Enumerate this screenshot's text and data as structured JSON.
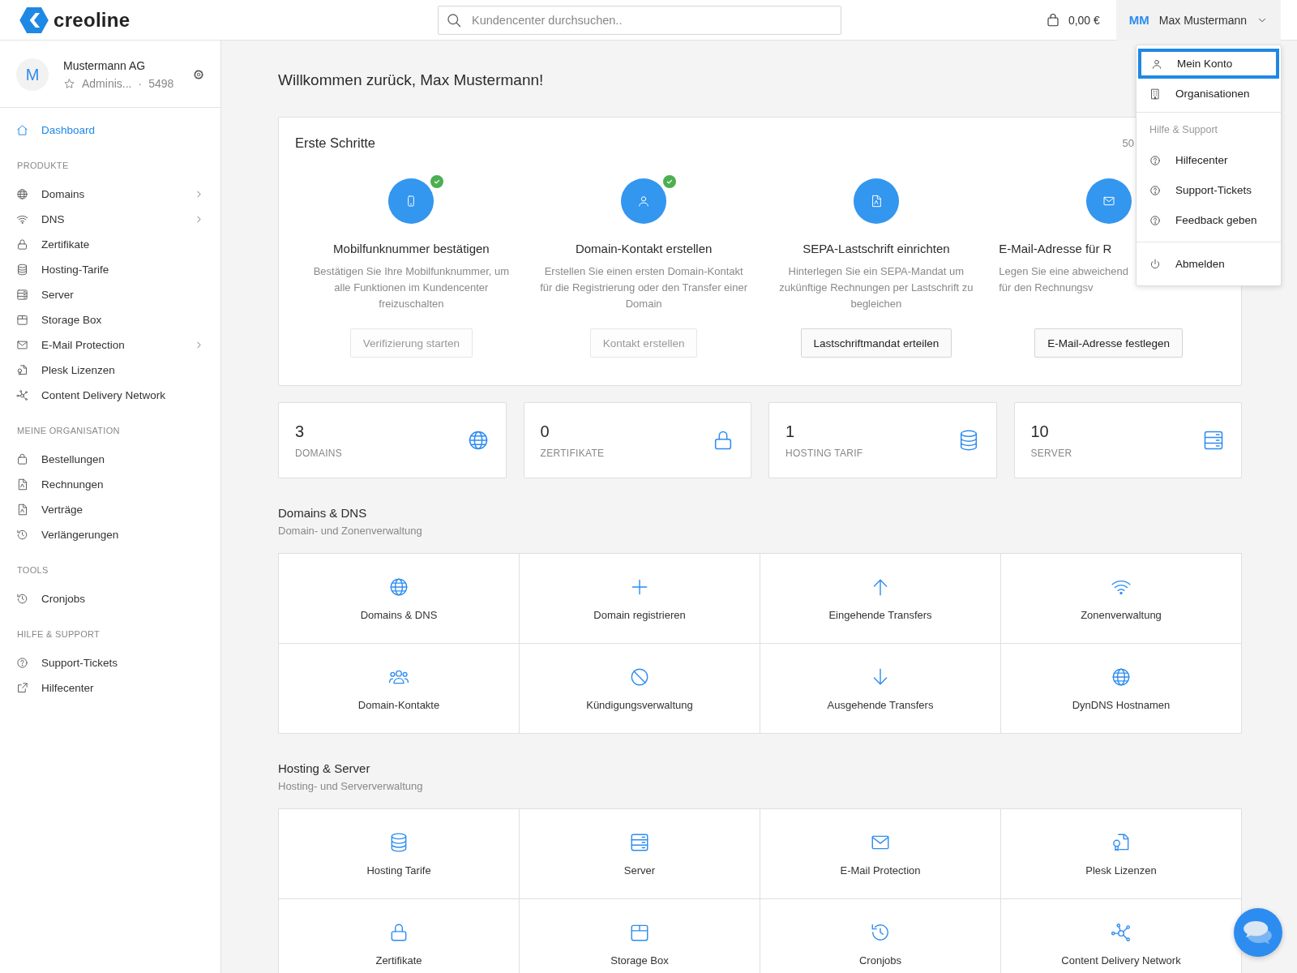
{
  "header": {
    "brand": "creoline",
    "search": {
      "placeholder": "Kundencenter durchsuchen.."
    },
    "cart_total": "0,00 €",
    "user": {
      "initials": "MM",
      "name": "Max Mustermann",
      "menu_open": true
    }
  },
  "user_menu": {
    "groups": [
      {
        "items": [
          {
            "label": "Mein Konto",
            "selected": true
          },
          {
            "label": "Organisationen",
            "selected": false
          }
        ]
      },
      {
        "heading": "Hilfe & Support",
        "items": [
          {
            "label": "Hilfecenter",
            "selected": false
          },
          {
            "label": "Support-Tickets",
            "selected": false
          },
          {
            "label": "Feedback geben",
            "selected": false
          }
        ]
      },
      {
        "items": [
          {
            "label": "Abmelden",
            "selected": false
          }
        ]
      }
    ]
  },
  "sidebar": {
    "organization": {
      "avatar": "M",
      "name": "Mustermann AG",
      "role": "Adminis...",
      "separator": "·",
      "number": "5498"
    },
    "sections": [
      {
        "items": [
          {
            "label": "Dashboard",
            "selected": true,
            "expandable": false
          }
        ]
      },
      {
        "heading": "PRODUKTE",
        "items": [
          {
            "label": "Domains",
            "selected": false,
            "expandable": true
          },
          {
            "label": "DNS",
            "selected": false,
            "expandable": true
          },
          {
            "label": "Zertifikate",
            "selected": false,
            "expandable": false
          },
          {
            "label": "Hosting-Tarife",
            "selected": false,
            "expandable": false
          },
          {
            "label": "Server",
            "selected": false,
            "expandable": false
          },
          {
            "label": "Storage Box",
            "selected": false,
            "expandable": false
          },
          {
            "label": "E-Mail Protection",
            "selected": false,
            "expandable": true
          },
          {
            "label": "Plesk Lizenzen",
            "selected": false,
            "expandable": false
          },
          {
            "label": "Content Delivery Network",
            "selected": false,
            "expandable": false
          }
        ]
      },
      {
        "heading": "MEINE ORGANISATION",
        "items": [
          {
            "label": "Bestellungen",
            "selected": false,
            "expandable": false
          },
          {
            "label": "Rechnungen",
            "selected": false,
            "expandable": false
          },
          {
            "label": "Verträge",
            "selected": false,
            "expandable": false
          },
          {
            "label": "Verlängerungen",
            "selected": false,
            "expandable": false
          }
        ]
      },
      {
        "heading": "TOOLS",
        "items": [
          {
            "label": "Cronjobs",
            "selected": false,
            "expandable": false
          }
        ]
      },
      {
        "heading": "HILFE & SUPPORT",
        "items": [
          {
            "label": "Support-Tickets",
            "selected": false,
            "expandable": false
          },
          {
            "label": "Hilfecenter",
            "selected": false,
            "expandable": false
          }
        ]
      }
    ]
  },
  "welcome": "Willkommen zurück, Max Mustermann!",
  "first_steps": {
    "title": "Erste Schritte",
    "progress": "50",
    "steps": [
      {
        "title": "Mobilfunknummer bestätigen",
        "description": [
          "Bestätigen Sie Ihre Mobilfunknummer, um",
          "alle Funktionen im Kundencenter",
          "freizuschalten"
        ],
        "button": "Verifizierung starten",
        "done": true
      },
      {
        "title": "Domain-Kontakt erstellen",
        "description": [
          "Erstellen Sie einen ersten Domain-Kontakt",
          "für die Registrierung oder den Transfer einer",
          "Domain"
        ],
        "button": "Kontakt erstellen",
        "done": true
      },
      {
        "title": "SEPA-Lastschrift einrichten",
        "description": [
          "Hinterlegen Sie ein SEPA-Mandat um",
          "zukünftige Rechnungen per Lastschrift zu",
          "begleichen"
        ],
        "button": "Lastschriftmandat erteilen",
        "done": false
      },
      {
        "title": "E-Mail-Adresse für R",
        "description": [
          "Legen Sie eine abweichend",
          "für den Rechnungsv"
        ],
        "button": "E-Mail-Adresse festlegen",
        "done": false
      }
    ]
  },
  "stats": [
    {
      "value": "3",
      "label": "DOMAINS"
    },
    {
      "value": "0",
      "label": "ZERTIFIKATE"
    },
    {
      "value": "1",
      "label": "HOSTING TARIF"
    },
    {
      "value": "10",
      "label": "SERVER"
    }
  ],
  "sections": [
    {
      "title": "Domains & DNS",
      "subtitle": "Domain- und Zonenverwaltung",
      "tiles": [
        "Domains & DNS",
        "Domain registrieren",
        "Eingehende Transfers",
        "Zonenverwaltung",
        "Domain-Kontakte",
        "Kündigungsverwaltung",
        "Ausgehende Transfers",
        "DynDNS Hostnamen"
      ]
    },
    {
      "title": "Hosting & Server",
      "subtitle": "Hosting- und Serververwaltung",
      "tiles": [
        "Hosting Tarife",
        "Server",
        "E-Mail Protection",
        "Plesk Lizenzen",
        "Zertifikate",
        "Storage Box",
        "Cronjobs",
        "Content Delivery Network"
      ]
    }
  ]
}
